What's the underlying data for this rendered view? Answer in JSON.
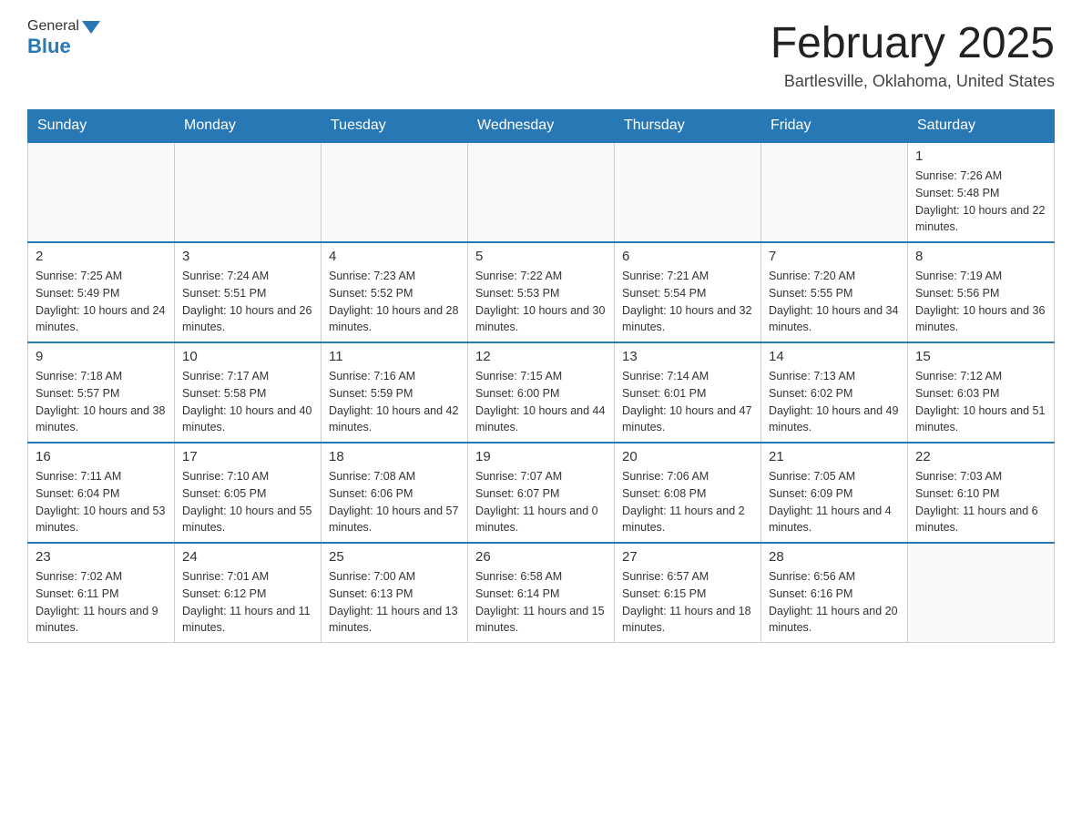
{
  "header": {
    "title": "February 2025",
    "location": "Bartlesville, Oklahoma, United States",
    "logo_general": "General",
    "logo_blue": "Blue"
  },
  "days_of_week": [
    "Sunday",
    "Monday",
    "Tuesday",
    "Wednesday",
    "Thursday",
    "Friday",
    "Saturday"
  ],
  "weeks": [
    {
      "days": [
        {
          "num": "",
          "info": ""
        },
        {
          "num": "",
          "info": ""
        },
        {
          "num": "",
          "info": ""
        },
        {
          "num": "",
          "info": ""
        },
        {
          "num": "",
          "info": ""
        },
        {
          "num": "",
          "info": ""
        },
        {
          "num": "1",
          "info": "Sunrise: 7:26 AM\nSunset: 5:48 PM\nDaylight: 10 hours and 22 minutes."
        }
      ]
    },
    {
      "days": [
        {
          "num": "2",
          "info": "Sunrise: 7:25 AM\nSunset: 5:49 PM\nDaylight: 10 hours and 24 minutes."
        },
        {
          "num": "3",
          "info": "Sunrise: 7:24 AM\nSunset: 5:51 PM\nDaylight: 10 hours and 26 minutes."
        },
        {
          "num": "4",
          "info": "Sunrise: 7:23 AM\nSunset: 5:52 PM\nDaylight: 10 hours and 28 minutes."
        },
        {
          "num": "5",
          "info": "Sunrise: 7:22 AM\nSunset: 5:53 PM\nDaylight: 10 hours and 30 minutes."
        },
        {
          "num": "6",
          "info": "Sunrise: 7:21 AM\nSunset: 5:54 PM\nDaylight: 10 hours and 32 minutes."
        },
        {
          "num": "7",
          "info": "Sunrise: 7:20 AM\nSunset: 5:55 PM\nDaylight: 10 hours and 34 minutes."
        },
        {
          "num": "8",
          "info": "Sunrise: 7:19 AM\nSunset: 5:56 PM\nDaylight: 10 hours and 36 minutes."
        }
      ]
    },
    {
      "days": [
        {
          "num": "9",
          "info": "Sunrise: 7:18 AM\nSunset: 5:57 PM\nDaylight: 10 hours and 38 minutes."
        },
        {
          "num": "10",
          "info": "Sunrise: 7:17 AM\nSunset: 5:58 PM\nDaylight: 10 hours and 40 minutes."
        },
        {
          "num": "11",
          "info": "Sunrise: 7:16 AM\nSunset: 5:59 PM\nDaylight: 10 hours and 42 minutes."
        },
        {
          "num": "12",
          "info": "Sunrise: 7:15 AM\nSunset: 6:00 PM\nDaylight: 10 hours and 44 minutes."
        },
        {
          "num": "13",
          "info": "Sunrise: 7:14 AM\nSunset: 6:01 PM\nDaylight: 10 hours and 47 minutes."
        },
        {
          "num": "14",
          "info": "Sunrise: 7:13 AM\nSunset: 6:02 PM\nDaylight: 10 hours and 49 minutes."
        },
        {
          "num": "15",
          "info": "Sunrise: 7:12 AM\nSunset: 6:03 PM\nDaylight: 10 hours and 51 minutes."
        }
      ]
    },
    {
      "days": [
        {
          "num": "16",
          "info": "Sunrise: 7:11 AM\nSunset: 6:04 PM\nDaylight: 10 hours and 53 minutes."
        },
        {
          "num": "17",
          "info": "Sunrise: 7:10 AM\nSunset: 6:05 PM\nDaylight: 10 hours and 55 minutes."
        },
        {
          "num": "18",
          "info": "Sunrise: 7:08 AM\nSunset: 6:06 PM\nDaylight: 10 hours and 57 minutes."
        },
        {
          "num": "19",
          "info": "Sunrise: 7:07 AM\nSunset: 6:07 PM\nDaylight: 11 hours and 0 minutes."
        },
        {
          "num": "20",
          "info": "Sunrise: 7:06 AM\nSunset: 6:08 PM\nDaylight: 11 hours and 2 minutes."
        },
        {
          "num": "21",
          "info": "Sunrise: 7:05 AM\nSunset: 6:09 PM\nDaylight: 11 hours and 4 minutes."
        },
        {
          "num": "22",
          "info": "Sunrise: 7:03 AM\nSunset: 6:10 PM\nDaylight: 11 hours and 6 minutes."
        }
      ]
    },
    {
      "days": [
        {
          "num": "23",
          "info": "Sunrise: 7:02 AM\nSunset: 6:11 PM\nDaylight: 11 hours and 9 minutes."
        },
        {
          "num": "24",
          "info": "Sunrise: 7:01 AM\nSunset: 6:12 PM\nDaylight: 11 hours and 11 minutes."
        },
        {
          "num": "25",
          "info": "Sunrise: 7:00 AM\nSunset: 6:13 PM\nDaylight: 11 hours and 13 minutes."
        },
        {
          "num": "26",
          "info": "Sunrise: 6:58 AM\nSunset: 6:14 PM\nDaylight: 11 hours and 15 minutes."
        },
        {
          "num": "27",
          "info": "Sunrise: 6:57 AM\nSunset: 6:15 PM\nDaylight: 11 hours and 18 minutes."
        },
        {
          "num": "28",
          "info": "Sunrise: 6:56 AM\nSunset: 6:16 PM\nDaylight: 11 hours and 20 minutes."
        },
        {
          "num": "",
          "info": ""
        }
      ]
    }
  ]
}
